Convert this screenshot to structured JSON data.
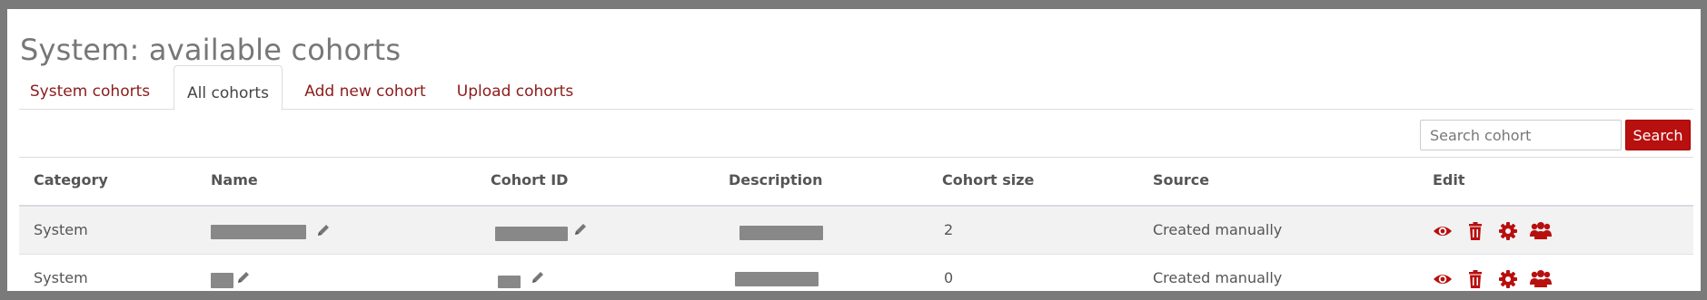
{
  "page": {
    "title": "System: available cohorts"
  },
  "tabs": [
    {
      "label": "System cohorts",
      "active": false
    },
    {
      "label": "All cohorts",
      "active": true
    },
    {
      "label": "Add new cohort",
      "active": false
    },
    {
      "label": "Upload cohorts",
      "active": false
    }
  ],
  "search": {
    "placeholder": "Search cohort",
    "button_label": "Search"
  },
  "table": {
    "headers": [
      "Category",
      "Name",
      "Cohort ID",
      "Description",
      "Cohort size",
      "Source",
      "Edit"
    ],
    "rows": [
      {
        "category": "System",
        "name": "",
        "cohort_id": "",
        "description": "",
        "size": "2",
        "source": "Created manually"
      },
      {
        "category": "System",
        "name": "",
        "cohort_id": "",
        "description": "",
        "size": "0",
        "source": "Created manually"
      }
    ]
  },
  "icons": {
    "view": "eye-icon",
    "delete": "trash-icon",
    "settings": "gear-icon",
    "members": "users-icon",
    "edit_inline": "pencil-icon"
  },
  "colors": {
    "accent": "#b80f0f",
    "link": "#8c1b1b",
    "redaction": "#888888"
  }
}
